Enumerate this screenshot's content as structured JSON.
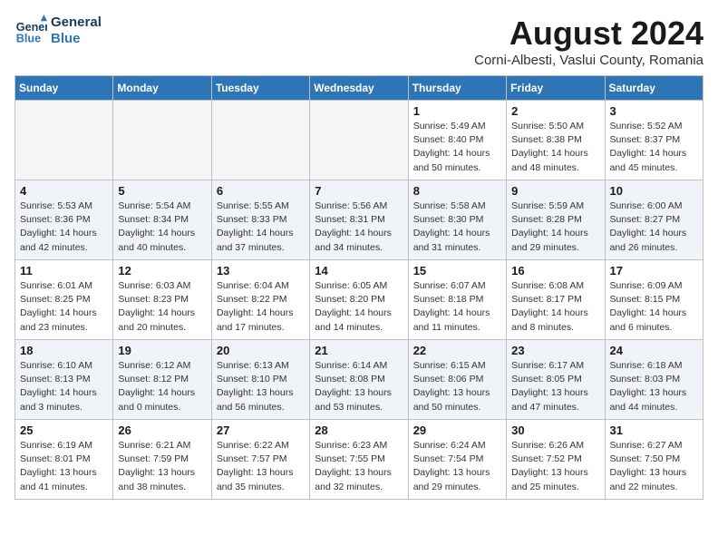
{
  "header": {
    "logo_line1": "General",
    "logo_line2": "Blue",
    "month_year": "August 2024",
    "location": "Corni-Albesti, Vaslui County, Romania"
  },
  "weekdays": [
    "Sunday",
    "Monday",
    "Tuesday",
    "Wednesday",
    "Thursday",
    "Friday",
    "Saturday"
  ],
  "weeks": [
    [
      {
        "day": "",
        "info": ""
      },
      {
        "day": "",
        "info": ""
      },
      {
        "day": "",
        "info": ""
      },
      {
        "day": "",
        "info": ""
      },
      {
        "day": "1",
        "info": "Sunrise: 5:49 AM\nSunset: 8:40 PM\nDaylight: 14 hours\nand 50 minutes."
      },
      {
        "day": "2",
        "info": "Sunrise: 5:50 AM\nSunset: 8:38 PM\nDaylight: 14 hours\nand 48 minutes."
      },
      {
        "day": "3",
        "info": "Sunrise: 5:52 AM\nSunset: 8:37 PM\nDaylight: 14 hours\nand 45 minutes."
      }
    ],
    [
      {
        "day": "4",
        "info": "Sunrise: 5:53 AM\nSunset: 8:36 PM\nDaylight: 14 hours\nand 42 minutes."
      },
      {
        "day": "5",
        "info": "Sunrise: 5:54 AM\nSunset: 8:34 PM\nDaylight: 14 hours\nand 40 minutes."
      },
      {
        "day": "6",
        "info": "Sunrise: 5:55 AM\nSunset: 8:33 PM\nDaylight: 14 hours\nand 37 minutes."
      },
      {
        "day": "7",
        "info": "Sunrise: 5:56 AM\nSunset: 8:31 PM\nDaylight: 14 hours\nand 34 minutes."
      },
      {
        "day": "8",
        "info": "Sunrise: 5:58 AM\nSunset: 8:30 PM\nDaylight: 14 hours\nand 31 minutes."
      },
      {
        "day": "9",
        "info": "Sunrise: 5:59 AM\nSunset: 8:28 PM\nDaylight: 14 hours\nand 29 minutes."
      },
      {
        "day": "10",
        "info": "Sunrise: 6:00 AM\nSunset: 8:27 PM\nDaylight: 14 hours\nand 26 minutes."
      }
    ],
    [
      {
        "day": "11",
        "info": "Sunrise: 6:01 AM\nSunset: 8:25 PM\nDaylight: 14 hours\nand 23 minutes."
      },
      {
        "day": "12",
        "info": "Sunrise: 6:03 AM\nSunset: 8:23 PM\nDaylight: 14 hours\nand 20 minutes."
      },
      {
        "day": "13",
        "info": "Sunrise: 6:04 AM\nSunset: 8:22 PM\nDaylight: 14 hours\nand 17 minutes."
      },
      {
        "day": "14",
        "info": "Sunrise: 6:05 AM\nSunset: 8:20 PM\nDaylight: 14 hours\nand 14 minutes."
      },
      {
        "day": "15",
        "info": "Sunrise: 6:07 AM\nSunset: 8:18 PM\nDaylight: 14 hours\nand 11 minutes."
      },
      {
        "day": "16",
        "info": "Sunrise: 6:08 AM\nSunset: 8:17 PM\nDaylight: 14 hours\nand 8 minutes."
      },
      {
        "day": "17",
        "info": "Sunrise: 6:09 AM\nSunset: 8:15 PM\nDaylight: 14 hours\nand 6 minutes."
      }
    ],
    [
      {
        "day": "18",
        "info": "Sunrise: 6:10 AM\nSunset: 8:13 PM\nDaylight: 14 hours\nand 3 minutes."
      },
      {
        "day": "19",
        "info": "Sunrise: 6:12 AM\nSunset: 8:12 PM\nDaylight: 14 hours\nand 0 minutes."
      },
      {
        "day": "20",
        "info": "Sunrise: 6:13 AM\nSunset: 8:10 PM\nDaylight: 13 hours\nand 56 minutes."
      },
      {
        "day": "21",
        "info": "Sunrise: 6:14 AM\nSunset: 8:08 PM\nDaylight: 13 hours\nand 53 minutes."
      },
      {
        "day": "22",
        "info": "Sunrise: 6:15 AM\nSunset: 8:06 PM\nDaylight: 13 hours\nand 50 minutes."
      },
      {
        "day": "23",
        "info": "Sunrise: 6:17 AM\nSunset: 8:05 PM\nDaylight: 13 hours\nand 47 minutes."
      },
      {
        "day": "24",
        "info": "Sunrise: 6:18 AM\nSunset: 8:03 PM\nDaylight: 13 hours\nand 44 minutes."
      }
    ],
    [
      {
        "day": "25",
        "info": "Sunrise: 6:19 AM\nSunset: 8:01 PM\nDaylight: 13 hours\nand 41 minutes."
      },
      {
        "day": "26",
        "info": "Sunrise: 6:21 AM\nSunset: 7:59 PM\nDaylight: 13 hours\nand 38 minutes."
      },
      {
        "day": "27",
        "info": "Sunrise: 6:22 AM\nSunset: 7:57 PM\nDaylight: 13 hours\nand 35 minutes."
      },
      {
        "day": "28",
        "info": "Sunrise: 6:23 AM\nSunset: 7:55 PM\nDaylight: 13 hours\nand 32 minutes."
      },
      {
        "day": "29",
        "info": "Sunrise: 6:24 AM\nSunset: 7:54 PM\nDaylight: 13 hours\nand 29 minutes."
      },
      {
        "day": "30",
        "info": "Sunrise: 6:26 AM\nSunset: 7:52 PM\nDaylight: 13 hours\nand 25 minutes."
      },
      {
        "day": "31",
        "info": "Sunrise: 6:27 AM\nSunset: 7:50 PM\nDaylight: 13 hours\nand 22 minutes."
      }
    ]
  ]
}
